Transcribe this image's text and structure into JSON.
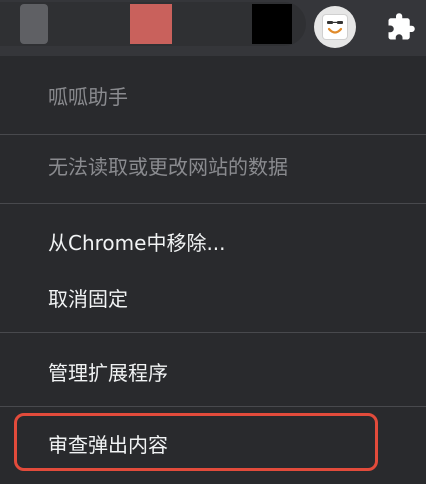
{
  "toolbar": {
    "extension_icon": "custom-smiley-icon",
    "extensions_menu_icon": "puzzle-icon"
  },
  "menu": {
    "items": [
      {
        "label": "呱呱助手"
      },
      {
        "label": "无法读取或更改网站的数据"
      },
      {
        "label": "从Chrome中移除..."
      },
      {
        "label": "取消固定"
      },
      {
        "label": "管理扩展程序"
      },
      {
        "label": "审查弹出内容"
      }
    ]
  },
  "colors": {
    "menu_bg": "#292a2d",
    "text": "#f1f3f4",
    "disabled_text": "#8a8b8f",
    "highlight": "#e24b3b"
  }
}
